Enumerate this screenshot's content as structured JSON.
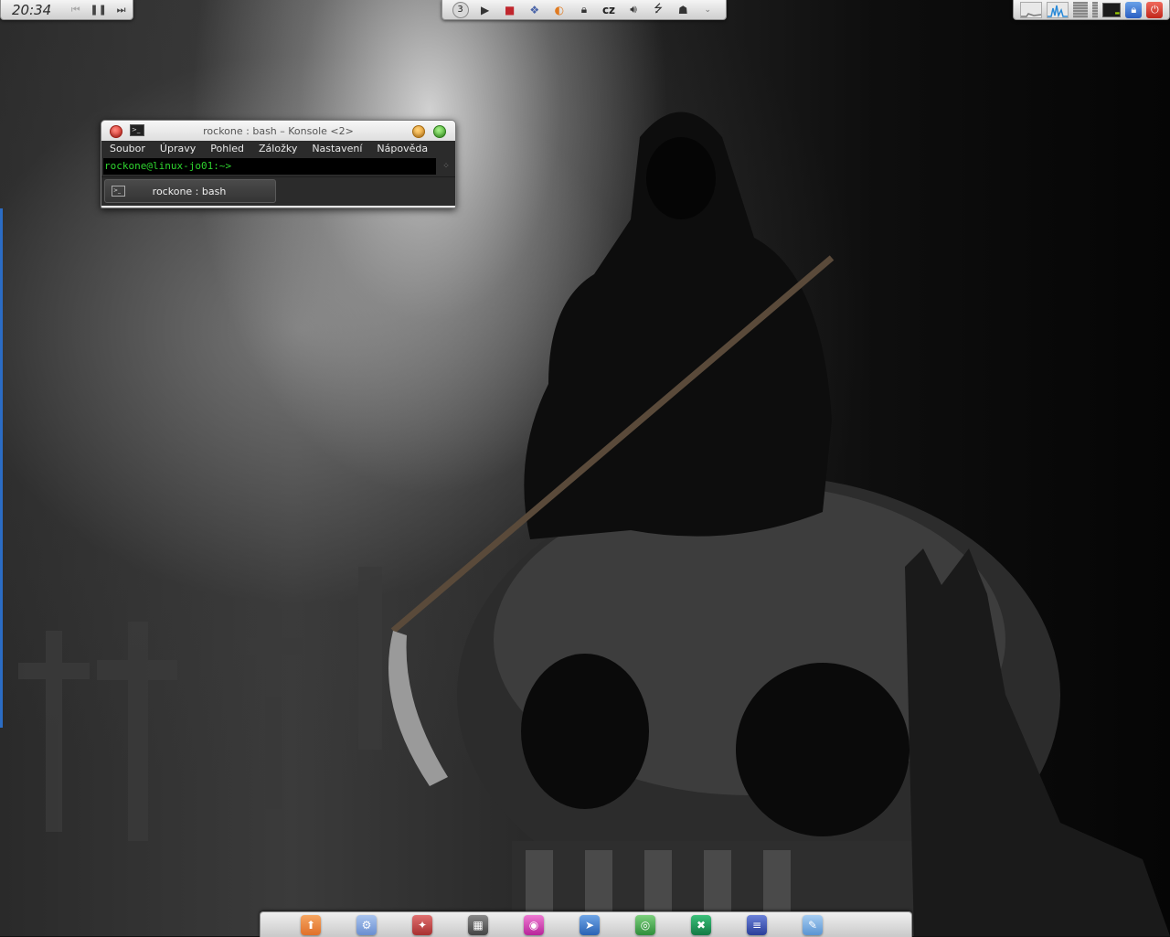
{
  "top_left_panel": {
    "clock": "20:34",
    "media": [
      {
        "name": "previous-track-icon",
        "glyph": "⏮",
        "enabled": false
      },
      {
        "name": "pause-icon",
        "glyph": "❚❚",
        "enabled": true
      },
      {
        "name": "next-track-icon",
        "glyph": "⏭",
        "enabled": true
      }
    ]
  },
  "top_center_panel": {
    "desktop_number": "3",
    "language": "cz",
    "icons": [
      "play-icon",
      "media-recorder-icon",
      "weather-icon",
      "clipboard-icon",
      "lock-icon",
      "volume-icon",
      "usb-icon",
      "network-icon",
      "expand-arrow-icon"
    ]
  },
  "top_right_panel": {
    "icons": [
      "network-graph-icon",
      "cpu-graph-icon",
      "memory-bar-icon",
      "terminal-icon",
      "lock-screen-icon",
      "power-icon"
    ],
    "colors": {
      "lock": "#2a5ec2",
      "power": "#c0261b"
    }
  },
  "konsole": {
    "title": "rockone : bash – Konsole <2>",
    "menu": [
      "Soubor",
      "Úpravy",
      "Pohled",
      "Záložky",
      "Nastavení",
      "Nápověda"
    ],
    "prompt": "rockone@linux-jo01:~>",
    "tab_label": "rockone : bash",
    "colors": {
      "prompt": "#2fd42f",
      "background": "#2b2b2b"
    }
  },
  "dock": {
    "items": [
      {
        "name": "dock-app-1-icon",
        "color": "#f08a3c",
        "glyph": "⬆"
      },
      {
        "name": "dock-app-2-icon",
        "color": "#7a9ed8",
        "glyph": "⚙"
      },
      {
        "name": "dock-app-3-icon",
        "color": "#c04040",
        "glyph": "✦"
      },
      {
        "name": "dock-app-4-icon",
        "color": "#555555",
        "glyph": "▦"
      },
      {
        "name": "dock-app-5-icon",
        "color": "#d23fb3",
        "glyph": "◉"
      },
      {
        "name": "dock-app-6-icon",
        "color": "#3a78c8",
        "glyph": "➤"
      },
      {
        "name": "dock-app-7-icon",
        "color": "#3da34a",
        "glyph": "◎"
      },
      {
        "name": "dock-app-8-icon",
        "color": "#1e9c5a",
        "glyph": "✖"
      },
      {
        "name": "dock-app-9-icon",
        "color": "#3a52b4",
        "glyph": "≡"
      },
      {
        "name": "dock-app-10-icon",
        "color": "#6aa6e0",
        "glyph": "✎"
      }
    ]
  }
}
